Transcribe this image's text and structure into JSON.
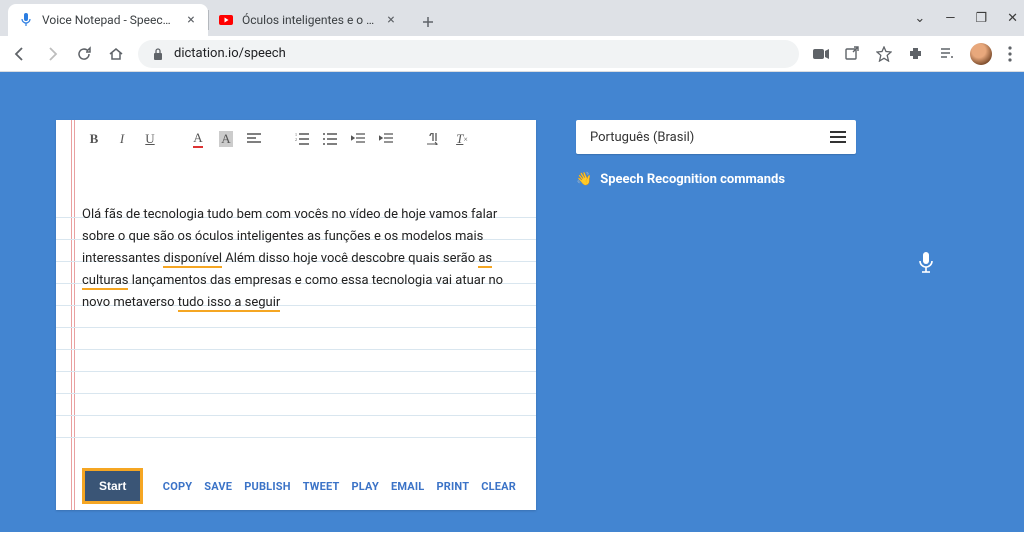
{
  "window": {
    "controls": {
      "minimize": "—",
      "maximize": "❐",
      "close": "✕",
      "chevron": "⌄"
    }
  },
  "tabs": [
    {
      "title": "Voice Notepad - Speech to Text",
      "active": true,
      "favicon": "🎤"
    },
    {
      "title": "Óculos inteligentes e o metaverso",
      "active": false,
      "favicon": "▶"
    }
  ],
  "address": {
    "lock": "🔒",
    "url": "dictation.io/speech"
  },
  "toolbar_icons": [
    "bold",
    "italic",
    "underline",
    "font-color",
    "highlight",
    "align",
    "ol",
    "ul",
    "outdent",
    "indent",
    "rtl",
    "clear-format"
  ],
  "editor": {
    "text_plain": "Olá fãs de tecnologia tudo bem com vocês no vídeo de hoje vamos falar sobre o que são os óculos inteligentes as funções e os modelos mais interessantes disponível Além disso hoje você descobre quais serão as culturas lançamentos das empresas e como essa tecnologia vai atuar no novo metaverso tudo isso a seguir",
    "underlined_phrases": [
      "disponível",
      "as culturas",
      "tudo isso a seguir"
    ]
  },
  "footer": {
    "primary": "Start",
    "actions": [
      "COPY",
      "SAVE",
      "PUBLISH",
      "TWEET",
      "PLAY",
      "EMAIL",
      "PRINT",
      "CLEAR"
    ]
  },
  "sidebar": {
    "language": "Português (Brasil)",
    "commands_label": "Speech Recognition commands",
    "commands_emoji": "👋"
  }
}
